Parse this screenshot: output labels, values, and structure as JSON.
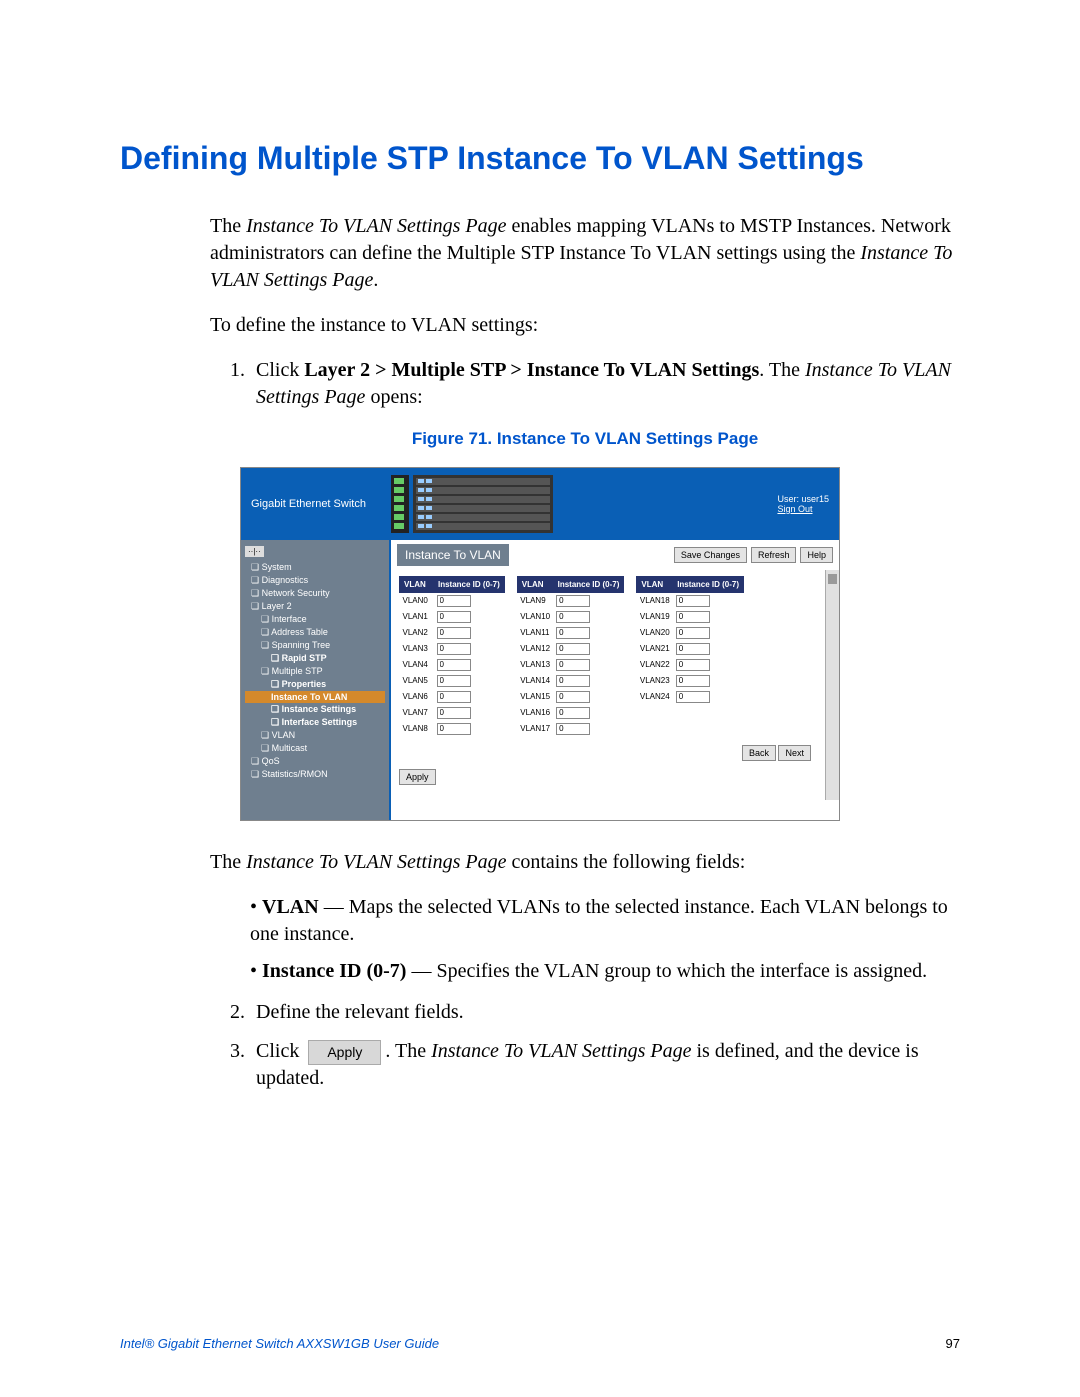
{
  "title": "Defining Multiple STP Instance To VLAN Settings",
  "intro_1a": "The ",
  "intro_1b": "Instance To VLAN Settings Page",
  "intro_1c": " enables mapping VLANs to MSTP Instances. Network administrators can define the Multiple STP Instance To VLAN settings using the ",
  "intro_1d": "Instance To VLAN Settings Page",
  "intro_1e": ".",
  "lead": "To define the instance to VLAN settings:",
  "step1_a": "Click ",
  "step1_b": "Layer 2 > Multiple STP > Instance To VLAN Settings",
  "step1_c": ". The ",
  "step1_d": "Instance To VLAN Settings Page",
  "step1_e": " opens:",
  "figcaption": "Figure 71. Instance To VLAN Settings Page",
  "below_fig_a": "The ",
  "below_fig_b": "Instance To VLAN Settings Page",
  "below_fig_c": " contains the following fields:",
  "bullet_vlan_b": "VLAN",
  "bullet_vlan_t": " — Maps the selected VLANs to the selected instance. Each VLAN belongs to one instance.",
  "bullet_inst_b": "Instance ID (0-7)",
  "bullet_inst_t": " — Specifies the VLAN group to which the interface is assigned.",
  "step2": "Define the relevant fields.",
  "step3_a": "Click ",
  "step3_btn": "Apply",
  "step3_b": ". The ",
  "step3_c": "Instance To VLAN Settings Page",
  "step3_d": " is defined, and the device is updated.",
  "footer_left": "Intel® Gigabit Ethernet Switch AXXSW1GB User Guide",
  "footer_page": "97",
  "ss": {
    "brand": "Gigabit Ethernet Switch",
    "user_label": "User: user15",
    "signout": "Sign Out",
    "panel_title": "Instance To VLAN",
    "btn_save": "Save Changes",
    "btn_refresh": "Refresh",
    "btn_help": "Help",
    "btn_back": "Back",
    "btn_next": "Next",
    "btn_apply": "Apply",
    "th_vlan": "VLAN",
    "th_inst": "Instance ID (0-7)",
    "nav": [
      {
        "t": "System",
        "l": 1
      },
      {
        "t": "Diagnostics",
        "l": 1
      },
      {
        "t": "Network Security",
        "l": 1
      },
      {
        "t": "Layer 2",
        "l": 1
      },
      {
        "t": "Interface",
        "l": 2
      },
      {
        "t": "Address Table",
        "l": 2
      },
      {
        "t": "Spanning Tree",
        "l": 2
      },
      {
        "t": "Rapid STP",
        "l": 3,
        "bold": true
      },
      {
        "t": "Multiple STP",
        "l": 2
      },
      {
        "t": "Properties",
        "l": 3,
        "bold": true
      },
      {
        "t": "Instance To VLAN",
        "l": 3,
        "sel": true,
        "bold": true
      },
      {
        "t": "Instance Settings",
        "l": 3,
        "bold": true
      },
      {
        "t": "Interface Settings",
        "l": 3,
        "bold": true
      },
      {
        "t": "VLAN",
        "l": 2
      },
      {
        "t": "Multicast",
        "l": 2
      },
      {
        "t": "QoS",
        "l": 1
      },
      {
        "t": "Statistics/RMON",
        "l": 1
      }
    ],
    "cols": [
      [
        {
          "label": "VLAN0",
          "val": "0"
        },
        {
          "label": "VLAN1",
          "val": "0"
        },
        {
          "label": "VLAN2",
          "val": "0"
        },
        {
          "label": "VLAN3",
          "val": "0"
        },
        {
          "label": "VLAN4",
          "val": "0"
        },
        {
          "label": "VLAN5",
          "val": "0"
        },
        {
          "label": "VLAN6",
          "val": "0"
        },
        {
          "label": "VLAN7",
          "val": "0"
        },
        {
          "label": "VLAN8",
          "val": "0"
        }
      ],
      [
        {
          "label": "VLAN9",
          "val": "0"
        },
        {
          "label": "VLAN10",
          "val": "0"
        },
        {
          "label": "VLAN11",
          "val": "0"
        },
        {
          "label": "VLAN12",
          "val": "0"
        },
        {
          "label": "VLAN13",
          "val": "0"
        },
        {
          "label": "VLAN14",
          "val": "0"
        },
        {
          "label": "VLAN15",
          "val": "0"
        },
        {
          "label": "VLAN16",
          "val": "0"
        },
        {
          "label": "VLAN17",
          "val": "0"
        }
      ],
      [
        {
          "label": "VLAN18",
          "val": "0"
        },
        {
          "label": "VLAN19",
          "val": "0"
        },
        {
          "label": "VLAN20",
          "val": "0"
        },
        {
          "label": "VLAN21",
          "val": "0"
        },
        {
          "label": "VLAN22",
          "val": "0"
        },
        {
          "label": "VLAN23",
          "val": "0"
        },
        {
          "label": "VLAN24",
          "val": "0"
        }
      ]
    ]
  }
}
